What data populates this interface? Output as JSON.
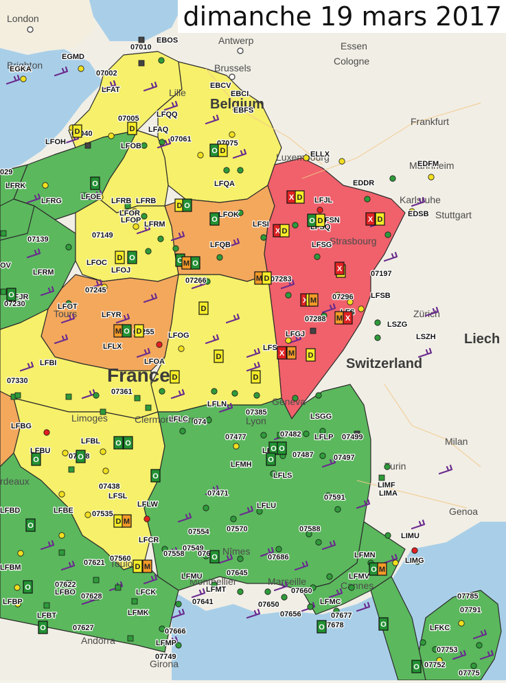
{
  "date_banner": "dimanche 19 mars 2017",
  "colors": {
    "sea": "#a9cfe8",
    "land": "#f1eee5",
    "green": "#5bb85d",
    "yellow": "#f6f06a",
    "orange": "#f3a85c",
    "red": "#f0616b",
    "border": "#2b2b2b"
  },
  "place_labels": [
    {
      "id": "london",
      "text": "London",
      "size": "small"
    },
    {
      "id": "antwerp",
      "text": "Antwerp",
      "size": "small"
    },
    {
      "id": "essen",
      "text": "Essen",
      "size": "small"
    },
    {
      "id": "cologne",
      "text": "Cologne",
      "size": "small"
    },
    {
      "id": "brussels",
      "text": "Brussels",
      "size": "small"
    },
    {
      "id": "lille",
      "text": "Lille",
      "size": "small"
    },
    {
      "id": "belgium",
      "text": "Belgium",
      "size": "big"
    },
    {
      "id": "frankfurt",
      "text": "Frankfurt",
      "size": "small"
    },
    {
      "id": "luxembourg",
      "text": "Luxembourg",
      "size": "small"
    },
    {
      "id": "mannheim",
      "text": "Mannheim",
      "size": "small"
    },
    {
      "id": "karlsruhe",
      "text": "Karlsruhe",
      "size": "small"
    },
    {
      "id": "stuttgart",
      "text": "Stuttgart",
      "size": "small"
    },
    {
      "id": "brighton",
      "text": "Brighton",
      "size": "small"
    },
    {
      "id": "strasbourg",
      "text": "Strasbourg",
      "size": "small"
    },
    {
      "id": "tours",
      "text": "Tours",
      "size": "small"
    },
    {
      "id": "zurich",
      "text": "Zürich",
      "size": "small"
    },
    {
      "id": "liech",
      "text": "Liech",
      "size": "big"
    },
    {
      "id": "switzerland",
      "text": "Switzerland",
      "size": "big"
    },
    {
      "id": "france",
      "text": "France",
      "size": "xl"
    },
    {
      "id": "limoges",
      "text": "Limoges",
      "size": "small"
    },
    {
      "id": "clermont",
      "text": "Clermont-Ferrand",
      "size": "small"
    },
    {
      "id": "lyon",
      "text": "Lyon",
      "size": "small"
    },
    {
      "id": "geneva",
      "text": "Geneva",
      "size": "small"
    },
    {
      "id": "milan",
      "text": "Milan",
      "size": "small"
    },
    {
      "id": "turin",
      "text": "Turin",
      "size": "small"
    },
    {
      "id": "bordeaux",
      "text": "rdeaux",
      "size": "small"
    },
    {
      "id": "genoa",
      "text": "Genoa",
      "size": "small"
    },
    {
      "id": "nimes",
      "text": "Nîmes",
      "size": "small"
    },
    {
      "id": "montpellier",
      "text": "Montpellier",
      "size": "small"
    },
    {
      "id": "marseille",
      "text": "Marseille",
      "size": "small"
    },
    {
      "id": "toulouse",
      "text": "Toulouse",
      "size": "small"
    },
    {
      "id": "cannes",
      "text": "Cannes",
      "size": "small"
    },
    {
      "id": "andorra",
      "text": "Andorra",
      "size": "small"
    },
    {
      "id": "girona",
      "text": "Girona",
      "size": "small"
    }
  ],
  "station_labels": [
    "EGMD",
    "EGKA",
    "EBOS",
    "07010",
    "07002",
    "LFAT",
    "EBCV",
    "EBCI",
    "EBFS",
    "07005",
    "LFQQ",
    "LFAQ",
    "07040",
    "07061",
    "07075",
    "LFOH",
    "LFOB",
    "ELLX",
    "EDFM",
    "EDDR",
    "029",
    "LFRK",
    "LFRG",
    "LFOE",
    "LFQA",
    "LFJL",
    "LFOK",
    "LFSN",
    "LFRB",
    "LFOR",
    "LFOP",
    "LFRM",
    "EDSB",
    "LFSI",
    "LFSQ",
    "07139",
    "07149",
    "LFQB",
    "LFSG",
    "LFOC",
    "LFOJ",
    "07266",
    "07283",
    "07197",
    "OV",
    "LFRM",
    "07245",
    "07230",
    "LFJR",
    "LFOT",
    "07296",
    "LFS",
    "LFSB",
    "LFYR",
    "07255",
    "07288",
    "LSZG",
    "LFGJ",
    "LSZH",
    "LFLX",
    "LFOG",
    "LFS",
    "LFBI",
    "LFOA",
    "07330",
    "07361",
    "LFLN",
    "07385",
    "LSGG",
    "LFBG",
    "LFLC",
    "074",
    "07477",
    "07482",
    "LFLP",
    "07499",
    "LFBU",
    "07428",
    "LFBL",
    "LFLY",
    "07487",
    "07497",
    "LFMH",
    "LFLS",
    "LIMF",
    "LIMA",
    "07438",
    "LFSL",
    "07591",
    "07471",
    "LFBD",
    "LFBE",
    "LFLW",
    "LFLU",
    "07535",
    "07554",
    "07570",
    "07588",
    "LIMU",
    "07549",
    "LFBM",
    "07630",
    "07558",
    "LFMN",
    "LIMG",
    "07621",
    "07622",
    "07645",
    "LFMU",
    "07686",
    "07660",
    "07628",
    "LFMT",
    "LFBO",
    "LFBP",
    "LFCK",
    "07641",
    "07650",
    "07785",
    "07791",
    "LFMC",
    "LFBT",
    "07677",
    "LFMK",
    "07656",
    "07678",
    "07627",
    "LFKC",
    "07666",
    "LFMP",
    "07753",
    "07749",
    "07752",
    "07775",
    "LFCR",
    "07560",
    "LFMV",
    "LFRB"
  ],
  "alert_badges": [
    {
      "code": "D"
    },
    {
      "code": "D"
    },
    {
      "code": "O"
    },
    {
      "code": "D"
    },
    {
      "code": "O"
    },
    {
      "code": "O"
    },
    {
      "code": "D"
    },
    {
      "code": "O"
    },
    {
      "code": "X"
    },
    {
      "code": "D"
    },
    {
      "code": "X"
    },
    {
      "code": "D"
    },
    {
      "code": "X"
    },
    {
      "code": "D"
    },
    {
      "code": "O"
    },
    {
      "code": "M"
    },
    {
      "code": "O"
    },
    {
      "code": "D"
    },
    {
      "code": "O"
    },
    {
      "code": "M"
    },
    {
      "code": "D"
    },
    {
      "code": "X"
    },
    {
      "code": "X"
    },
    {
      "code": "M"
    },
    {
      "code": "D"
    },
    {
      "code": "D"
    },
    {
      "code": "M"
    },
    {
      "code": "D"
    },
    {
      "code": "O"
    },
    {
      "code": "D"
    },
    {
      "code": "X"
    },
    {
      "code": "M"
    },
    {
      "code": "X"
    },
    {
      "code": "D"
    },
    {
      "code": "D"
    },
    {
      "code": "D"
    },
    {
      "code": "D"
    },
    {
      "code": "O"
    },
    {
      "code": "O"
    },
    {
      "code": "M"
    },
    {
      "code": "D"
    },
    {
      "code": "O"
    },
    {
      "code": "O"
    },
    {
      "code": "O"
    },
    {
      "code": "D"
    },
    {
      "code": "M"
    },
    {
      "code": "O"
    },
    {
      "code": "O"
    },
    {
      "code": "D"
    },
    {
      "code": "M"
    },
    {
      "code": "O"
    },
    {
      "code": "O"
    },
    {
      "code": "M"
    },
    {
      "code": "O"
    },
    {
      "code": "O"
    },
    {
      "code": "O"
    },
    {
      "code": "O"
    },
    {
      "code": "O"
    },
    {
      "code": "O"
    },
    {
      "code": "O"
    },
    {
      "code": "O"
    },
    {
      "code": "O"
    }
  ]
}
